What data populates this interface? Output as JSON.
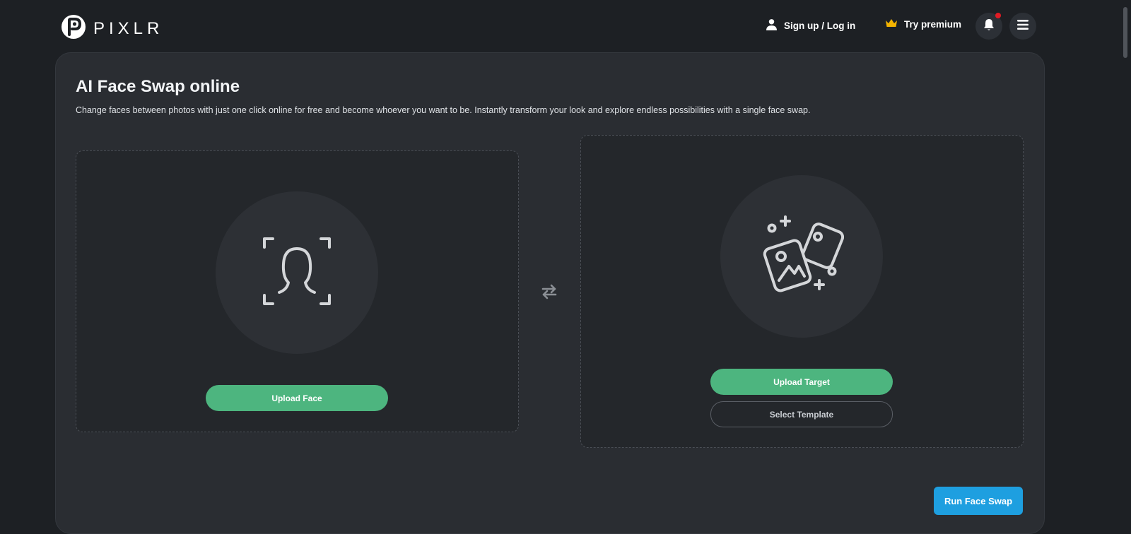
{
  "header": {
    "logo_text": "PIXLR",
    "signup_label": "Sign up / Log in",
    "premium_label": "Try premium",
    "icons": [
      "pixlr-logo-icon",
      "user-icon",
      "crown-icon",
      "bell-icon",
      "hamburger-menu-icon"
    ]
  },
  "main": {
    "title": "AI Face Swap online",
    "description": "Change faces between photos with just one click online for free and become whoever you want to be. Instantly transform your look and explore endless possibilities with a single face swap.",
    "face_zone": {
      "upload_label": "Upload Face",
      "icon": "face-scan-icon"
    },
    "swap_icon": "swap-arrows-icon",
    "target_zone": {
      "upload_label": "Upload Target",
      "template_label": "Select Template",
      "icon": "images-sparkle-icon"
    },
    "run_label": "Run Face Swap"
  },
  "colors": {
    "background": "#1d2024",
    "panel": "#2a2d32",
    "primary_green": "#4db57f",
    "run_blue": "#1e9fe0",
    "premium_gold": "#f5b400",
    "notification_red": "#e01b24"
  }
}
